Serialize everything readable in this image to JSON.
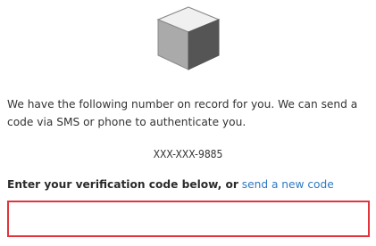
{
  "icons": {
    "device": "cube-icon"
  },
  "message": {
    "text": "We have the following number on record for you. We can send a code via SMS or phone to authenticate you."
  },
  "phone": {
    "masked_number": "XXX-XXX-9885"
  },
  "verification": {
    "prompt": "Enter your verification code below, or",
    "send_link": "send a new code",
    "input_value": "",
    "input_placeholder": ""
  },
  "colors": {
    "link": "#2f79c2",
    "input_border": "#e3343b",
    "cube_top": "#f0f0f0",
    "cube_left": "#aaaaaa",
    "cube_right": "#555555"
  }
}
